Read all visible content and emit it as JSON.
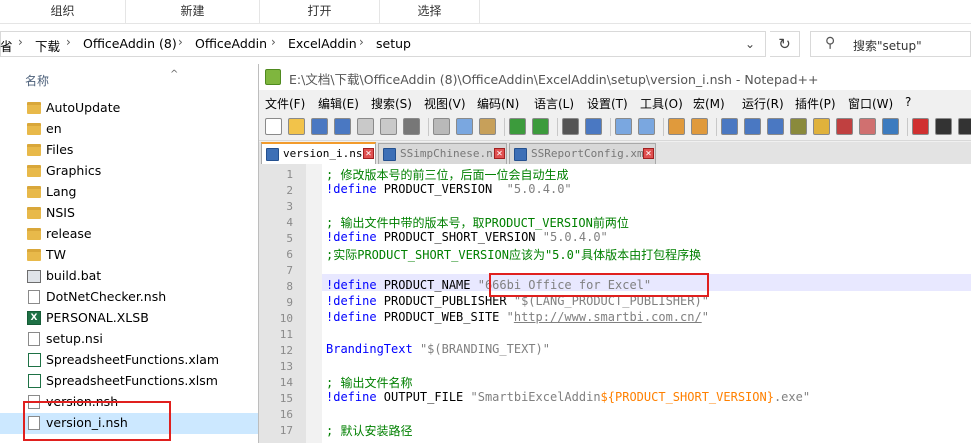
{
  "ribbon": {
    "groups": [
      "组织",
      "新建",
      "打开",
      "选择"
    ]
  },
  "address": {
    "crumbs": [
      "省",
      "下载",
      "OfficeAddin (8)",
      "OfficeAddin",
      "ExcelAddin",
      "setup"
    ],
    "search_text": "搜索\"setup\""
  },
  "filelist": {
    "column_header": "名称",
    "items": [
      {
        "name": "AutoUpdate",
        "type": "folder"
      },
      {
        "name": "en",
        "type": "folder"
      },
      {
        "name": "Files",
        "type": "folder"
      },
      {
        "name": "Graphics",
        "type": "folder"
      },
      {
        "name": "Lang",
        "type": "folder"
      },
      {
        "name": "NSIS",
        "type": "folder"
      },
      {
        "name": "release",
        "type": "folder"
      },
      {
        "name": "TW",
        "type": "folder"
      },
      {
        "name": "build.bat",
        "type": "bat"
      },
      {
        "name": "DotNetChecker.nsh",
        "type": "file"
      },
      {
        "name": "PERSONAL.XLSB",
        "type": "excel"
      },
      {
        "name": "setup.nsi",
        "type": "file"
      },
      {
        "name": "SpreadsheetFunctions.xlam",
        "type": "xls"
      },
      {
        "name": "SpreadsheetFunctions.xlsm",
        "type": "xls"
      },
      {
        "name": "version.nsh",
        "type": "file"
      },
      {
        "name": "version_i.nsh",
        "type": "file",
        "selected": true
      }
    ]
  },
  "npp": {
    "title": "E:\\文档\\下载\\OfficeAddin (8)\\OfficeAddin\\ExcelAddin\\setup\\version_i.nsh - Notepad++",
    "menus": [
      "文件(F)",
      "编辑(E)",
      "搜索(S)",
      "视图(V)",
      "编码(N)",
      "语言(L)",
      "设置(T)",
      "工具(O)",
      "宏(M)",
      "运行(R)",
      "插件(P)",
      "窗口(W)",
      "?"
    ],
    "tabs": [
      "version_i.nsh",
      "SSimpChinese.nsh",
      "SSReportConfig.xml"
    ],
    "lines": [
      {
        "n": "1",
        "parts": [
          {
            "t": "; 修改版本号的前三位，后面一位会自动生成",
            "c": "cmt"
          }
        ]
      },
      {
        "n": "2",
        "parts": [
          {
            "t": "!define",
            "c": "kw"
          },
          {
            "t": " PRODUCT_VERSION  ",
            "c": ""
          },
          {
            "t": "\"5.0.4.0\"",
            "c": "str"
          }
        ]
      },
      {
        "n": "3",
        "parts": []
      },
      {
        "n": "4",
        "parts": [
          {
            "t": "; 输出文件中带的版本号，取PRODUCT_VERSION前两位",
            "c": "cmt"
          }
        ]
      },
      {
        "n": "5",
        "parts": [
          {
            "t": "!define",
            "c": "kw"
          },
          {
            "t": " PRODUCT_SHORT_VERSION ",
            "c": ""
          },
          {
            "t": "\"5.0.4.0\"",
            "c": "str"
          }
        ]
      },
      {
        "n": "6",
        "parts": [
          {
            "t": ";实际PRODUCT_SHORT_VERSION应该为\"5.0\"具体版本由打包程序换",
            "c": "cmt"
          }
        ]
      },
      {
        "n": "7",
        "parts": []
      },
      {
        "n": "8",
        "parts": [
          {
            "t": "!define",
            "c": "kw"
          },
          {
            "t": " PRODUCT_NAME ",
            "c": ""
          },
          {
            "t": "\"666bi Office for Excel\"",
            "c": "str"
          }
        ]
      },
      {
        "n": "9",
        "parts": [
          {
            "t": "!define",
            "c": "kw"
          },
          {
            "t": " PRODUCT_PUBLISHER ",
            "c": ""
          },
          {
            "t": "\"$(LANG_PRODUCT_PUBLISHER)\"",
            "c": "str"
          }
        ]
      },
      {
        "n": "10",
        "parts": [
          {
            "t": "!define",
            "c": "kw"
          },
          {
            "t": " PRODUCT_WEB_SITE ",
            "c": ""
          },
          {
            "t": "\"",
            "c": "str"
          },
          {
            "t": "http://www.smartbi.com.cn/",
            "c": "str url"
          },
          {
            "t": "\"",
            "c": "str"
          }
        ]
      },
      {
        "n": "11",
        "parts": []
      },
      {
        "n": "12",
        "parts": [
          {
            "t": "BrandingText",
            "c": "kw"
          },
          {
            "t": " ",
            "c": ""
          },
          {
            "t": "\"$(BRANDING_TEXT)\"",
            "c": "str"
          }
        ]
      },
      {
        "n": "13",
        "parts": []
      },
      {
        "n": "14",
        "parts": [
          {
            "t": "; 输出文件名称",
            "c": "cmt"
          }
        ]
      },
      {
        "n": "15",
        "parts": [
          {
            "t": "!define",
            "c": "kw"
          },
          {
            "t": " OUTPUT_FILE ",
            "c": ""
          },
          {
            "t": "\"SmartbiExcelAddin",
            "c": "str"
          },
          {
            "t": "${PRODUCT_SHORT_VERSION}",
            "c": "var"
          },
          {
            "t": ".exe\"",
            "c": "str"
          }
        ]
      },
      {
        "n": "16",
        "parts": []
      },
      {
        "n": "17",
        "parts": [
          {
            "t": "; 默认安装路径",
            "c": "cmt"
          }
        ]
      }
    ]
  },
  "colors": {
    "highlight_box": "#e0201e",
    "selection": "#cce8ff"
  }
}
